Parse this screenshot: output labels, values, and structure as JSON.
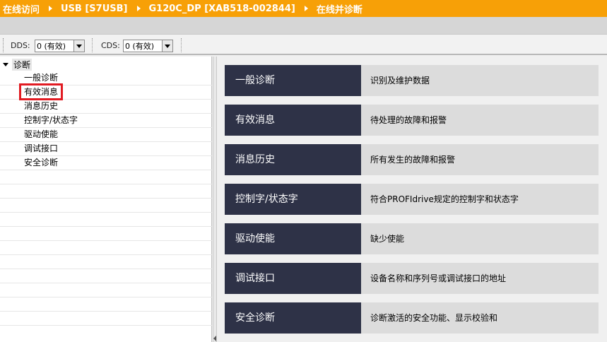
{
  "breadcrumb": [
    "在线访问",
    "USB [S7USB]",
    "G120C_DP [XAB518-002844]",
    "在线并诊断"
  ],
  "toolbar": {
    "dds_label": "DDS:",
    "dds_value": "0 (有效)",
    "cds_label": "CDS:",
    "cds_value": "0 (有效)"
  },
  "tree": {
    "root": "诊断",
    "items": [
      "一般诊断",
      "有效消息",
      "消息历史",
      "控制字/状态字",
      "驱动使能",
      "调试接口",
      "安全诊断"
    ],
    "selected": "有效消息"
  },
  "cards": [
    {
      "title": "一般诊断",
      "desc": "识别及维护数据"
    },
    {
      "title": "有效消息",
      "desc": "待处理的故障和报警"
    },
    {
      "title": "消息历史",
      "desc": "所有发生的故障和报警"
    },
    {
      "title": "控制字/状态字",
      "desc": "符合PROFIdrive规定的控制字和状态字"
    },
    {
      "title": "驱动使能",
      "desc": "缺少使能"
    },
    {
      "title": "调试接口",
      "desc": "设备名称和序列号或调试接口的地址"
    },
    {
      "title": "安全诊断",
      "desc": "诊断激活的安全功能、显示校验和"
    }
  ],
  "colors": {
    "titlebar": "#f7a007",
    "card_title_bg": "#2e3247",
    "card_desc_bg": "#dcdcdc",
    "highlight": "#e11b22"
  }
}
